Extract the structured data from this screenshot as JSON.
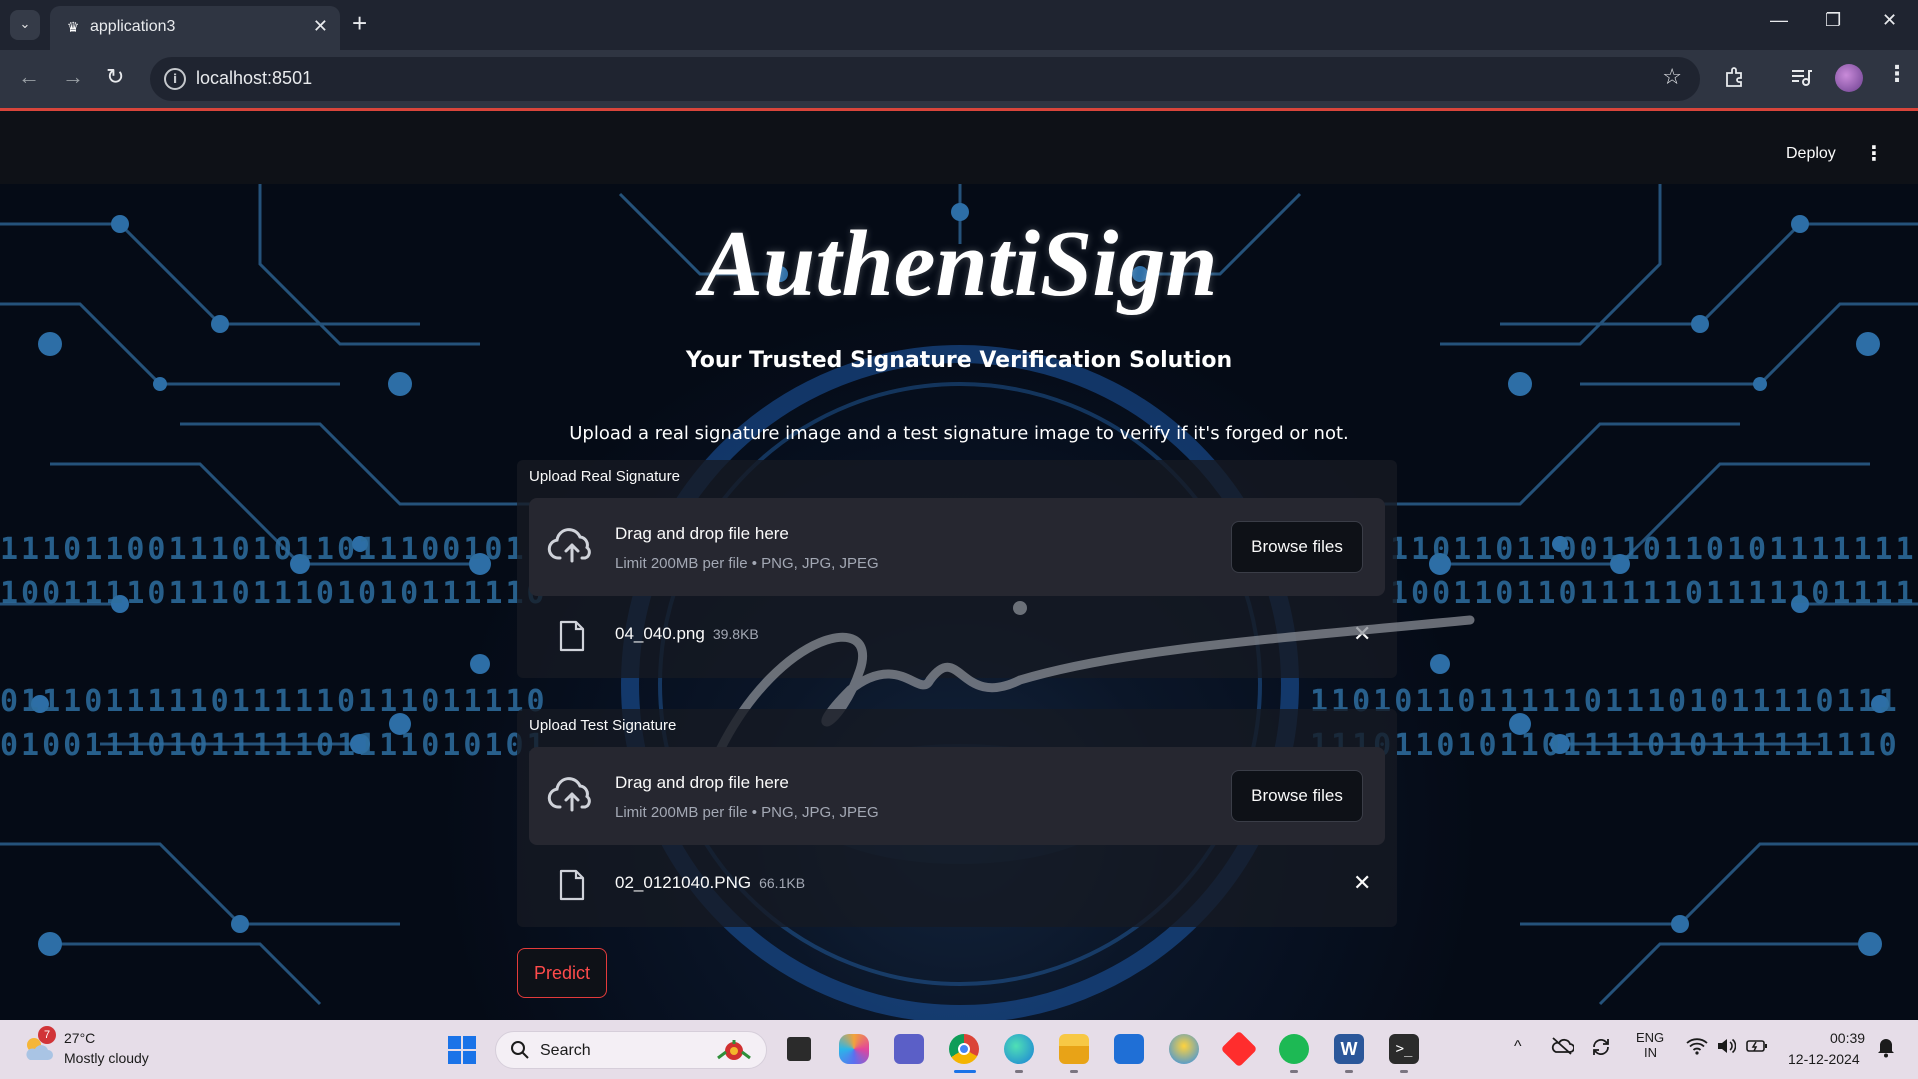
{
  "browser": {
    "tab_title": "application3",
    "tab_close": "✕",
    "new_tab": "+",
    "url": "localhost:8501",
    "window_controls": {
      "minimize": "—",
      "maximize": "❐",
      "close": "✕"
    },
    "nav": {
      "back": "←",
      "forward": "→",
      "reload": "↻"
    },
    "loading_bar_color": "#d8453b"
  },
  "streamlit_header": {
    "deploy_label": "Deploy",
    "menu_icon": "⋮"
  },
  "app": {
    "title": "AuthentiSign",
    "subtitle": "Your Trusted Signature Verification Solution",
    "instructions": "Upload a real signature image and a test signature image to verify if it's forged or not.",
    "background": {
      "binary_rows": [
        "11101100111010110111001011",
        "10011110111011101010111110",
        "01110111110111110111011110",
        "01001110101111101111010101"
      ],
      "binary_rows_right": [
        "1101101100110110101111111101",
        "1001101101111101111101111111",
        "1101011011111011101011110111",
        "1110110101101111010111111110"
      ]
    },
    "uploads": [
      {
        "label": "Upload Real Signature",
        "drop_title": "Drag and drop file here",
        "limit_text": "Limit 200MB per file • PNG, JPG, JPEG",
        "browse_label": "Browse files",
        "file_name": "04_040.png",
        "file_size": "39.8KB",
        "remove_icon": "✕"
      },
      {
        "label": "Upload Test Signature",
        "drop_title": "Drag and drop file here",
        "limit_text": "Limit 200MB per file • PNG, JPG, JPEG",
        "browse_label": "Browse files",
        "file_name": "02_0121040.PNG",
        "file_size": "66.1KB",
        "remove_icon": "✕"
      }
    ],
    "predict_label": "Predict",
    "accent_color": "#ff4b4b"
  },
  "taskbar": {
    "weather": {
      "badge": "7",
      "temp": "27°C",
      "desc": "Mostly cloudy"
    },
    "search_label": "Search",
    "apps": [
      "task-view-icon",
      "copilot-icon",
      "teams-icon",
      "chrome-icon",
      "edge-icon",
      "file-explorer-icon",
      "store-icon",
      "ai-assistant-icon",
      "red-diamond-app-icon",
      "spotify-icon",
      "word-icon",
      "terminal-icon"
    ],
    "tray": {
      "lang_top": "ENG",
      "lang_bottom": "IN",
      "chevron": "^"
    },
    "clock": {
      "time": "00:39",
      "date": "12-12-2024"
    }
  }
}
